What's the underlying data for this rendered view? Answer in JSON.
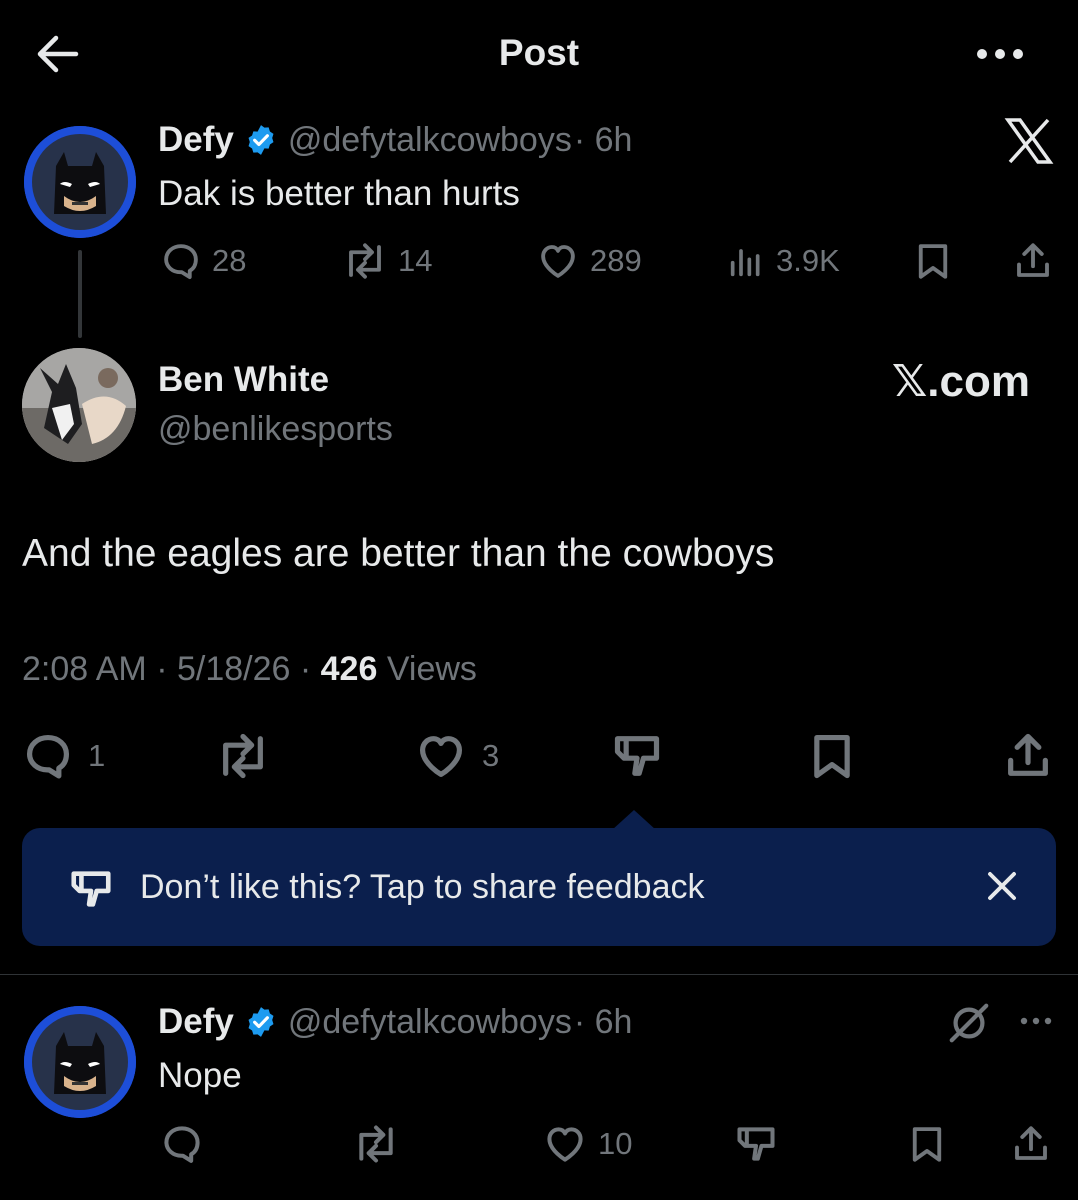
{
  "header": {
    "title": "Post",
    "back_icon": "back-arrow-icon",
    "more_icon": "more-horizontal-icon"
  },
  "quoted_tweet": {
    "name": "Defy",
    "handle": "@defytalkcowboys",
    "time": "· 6h",
    "text": "Dak is better than hurts",
    "stats": {
      "replies": "28",
      "reposts": "14",
      "likes": "289",
      "views": "3.9K"
    }
  },
  "main_tweet": {
    "name": "Ben White",
    "handle": "@benlikesports",
    "watermark": "𝕏.com",
    "text": "And the eagles are better than the cowboys",
    "time": "2:08 AM",
    "date": "· 5/18/26 ·",
    "views_count": "426",
    "views_label": "Views",
    "stats": {
      "replies": "1",
      "likes": "3"
    }
  },
  "feedback_banner": {
    "text": "Don’t like this? Tap to share feedback"
  },
  "reply_tweet": {
    "name": "Defy",
    "handle": "@defytalkcowboys",
    "time": "· 6h",
    "text": "Nope",
    "stats": {
      "likes": "10"
    }
  },
  "colors": {
    "background": "#000000",
    "banner": "#0b1f4d",
    "verified": "#1d9bf0",
    "muted": "#71767b"
  }
}
